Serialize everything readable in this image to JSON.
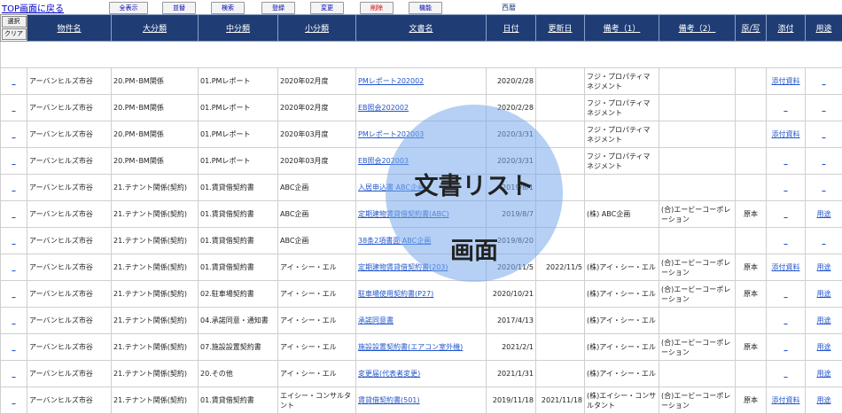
{
  "top": {
    "back_link": "TOP画面に戻る",
    "buttons": [
      "全表示",
      "並替",
      "検索",
      "登録",
      "変更",
      "削除",
      "機能"
    ],
    "period": "西暦"
  },
  "select_col": {
    "select_label": "選択",
    "clear_label": "クリア"
  },
  "headers": [
    "物件名",
    "大分類",
    "中分類",
    "小分類",
    "文書名",
    "日付",
    "更新日",
    "備考（1）",
    "備考（2）",
    "原/写",
    "添付",
    "用途"
  ],
  "rows": [
    {
      "mark": "_",
      "prop": "アーバンヒルズ市谷",
      "big": "20.PM･BM関係",
      "mid": "01.PMレポート",
      "small": "2020年02月度",
      "doc": "PMレポート202002",
      "date": "2020/2/28",
      "upd": "",
      "r1": "フジ・プロパティマネジメント",
      "r2": "",
      "orig": "",
      "att": "添付資料",
      "use": "_"
    },
    {
      "mark": "_",
      "prop": "アーバンヒルズ市谷",
      "big": "20.PM･BM関係",
      "mid": "01.PMレポート",
      "small": "2020年02月度",
      "doc": "EB照会202002",
      "date": "2020/2/28",
      "upd": "",
      "r1": "フジ・プロパティマネジメント",
      "r2": "",
      "orig": "",
      "att": "_",
      "use": "_"
    },
    {
      "mark": "_",
      "prop": "アーバンヒルズ市谷",
      "big": "20.PM･BM関係",
      "mid": "01.PMレポート",
      "small": "2020年03月度",
      "doc": "PMレポート202003",
      "date": "2020/3/31",
      "upd": "",
      "r1": "フジ・プロパティマネジメント",
      "r2": "",
      "orig": "",
      "att": "添付資料",
      "use": "_"
    },
    {
      "mark": "_",
      "prop": "アーバンヒルズ市谷",
      "big": "20.PM･BM関係",
      "mid": "01.PMレポート",
      "small": "2020年03月度",
      "doc": "EB照会202003",
      "date": "2020/3/31",
      "upd": "",
      "r1": "フジ・プロパティマネジメント",
      "r2": "",
      "orig": "",
      "att": "_",
      "use": "_"
    },
    {
      "mark": "_",
      "prop": "アーバンヒルズ市谷",
      "big": "21.テナント関係(契約)",
      "mid": "01.賃貸借契約書",
      "small": "ABC企画",
      "doc": "入居申込書 ABC企画",
      "date": "2019/8/1",
      "upd": "",
      "r1": "",
      "r2": "",
      "orig": "",
      "att": "_",
      "use": "_"
    },
    {
      "mark": "_",
      "prop": "アーバンヒルズ市谷",
      "big": "21.テナント関係(契約)",
      "mid": "01.賃貸借契約書",
      "small": "ABC企画",
      "doc": "定期建物賃貸借契約書(ABC)",
      "date": "2019/8/7",
      "upd": "",
      "r1": "(株) ABC企画",
      "r2": "(合)エービーコーポレーション",
      "orig": "原本",
      "att": "_",
      "use": "用途"
    },
    {
      "mark": "_",
      "prop": "アーバンヒルズ市谷",
      "big": "21.テナント関係(契約)",
      "mid": "01.賃貸借契約書",
      "small": "ABC企画",
      "doc": "38条2項書面 ABC企画",
      "date": "2019/8/20",
      "upd": "",
      "r1": "",
      "r2": "",
      "orig": "",
      "att": "_",
      "use": "_"
    },
    {
      "mark": "_",
      "prop": "アーバンヒルズ市谷",
      "big": "21.テナント関係(契約)",
      "mid": "01.賃貸借契約書",
      "small": "アイ・シー・エル",
      "doc": "定期建物賃貸借契約書(203)",
      "date": "2020/11/5",
      "upd": "2022/11/5",
      "r1": "(株)アイ・シー・エル",
      "r2": "(合)エービーコーポレーション",
      "orig": "原本",
      "att": "添付資料",
      "use": "用途"
    },
    {
      "mark": "_",
      "prop": "アーバンヒルズ市谷",
      "big": "21.テナント関係(契約)",
      "mid": "02.駐車場契約書",
      "small": "アイ・シー・エル",
      "doc": "駐車場使用契約書(P27)",
      "date": "2020/10/21",
      "upd": "",
      "r1": "(株)アイ・シー・エル",
      "r2": "(合)エービーコーポレーション",
      "orig": "原本",
      "att": "_",
      "use": "用途"
    },
    {
      "mark": "_",
      "prop": "アーバンヒルズ市谷",
      "big": "21.テナント関係(契約)",
      "mid": "04.承諾同意・通知書",
      "small": "アイ・シー・エル",
      "doc": "承諾同意書",
      "date": "2017/4/13",
      "upd": "",
      "r1": "(株)アイ・シー・エル",
      "r2": "",
      "orig": "",
      "att": "_",
      "use": "用途"
    },
    {
      "mark": "_",
      "prop": "アーバンヒルズ市谷",
      "big": "21.テナント関係(契約)",
      "mid": "07.施設設置契約書",
      "small": "アイ・シー・エル",
      "doc": "施設設置契約書(エアコン室外機)",
      "date": "2021/2/1",
      "upd": "",
      "r1": "(株)アイ・シー・エル",
      "r2": "(合)エービーコーポレーション",
      "orig": "原本",
      "att": "_",
      "use": "用途"
    },
    {
      "mark": "_",
      "prop": "アーバンヒルズ市谷",
      "big": "21.テナント関係(契約)",
      "mid": "20.その他",
      "small": "アイ・シー・エル",
      "doc": "変更届(代表者変更)",
      "date": "2021/1/31",
      "upd": "",
      "r1": "(株)アイ・シー・エル",
      "r2": "",
      "orig": "",
      "att": "_",
      "use": "用途"
    },
    {
      "mark": "_",
      "prop": "アーバンヒルズ市谷",
      "big": "21.テナント関係(契約)",
      "mid": "01.賃貸借契約書",
      "small": "エイシー・コンサルタント",
      "doc": "賃貸借契約書(501)",
      "date": "2019/11/18",
      "upd": "2021/11/18",
      "r1": "(株)エイシー・コンサルタント",
      "r2": "(合)エービーコーポレーション",
      "orig": "原本",
      "att": "添付資料",
      "use": "用途"
    }
  ],
  "overlay": {
    "line1": "文書リスト",
    "line2": "画面"
  },
  "colors": {
    "header_bg": "#1f3c74",
    "link": "#2255cc",
    "overlay": "#78aaeb"
  }
}
